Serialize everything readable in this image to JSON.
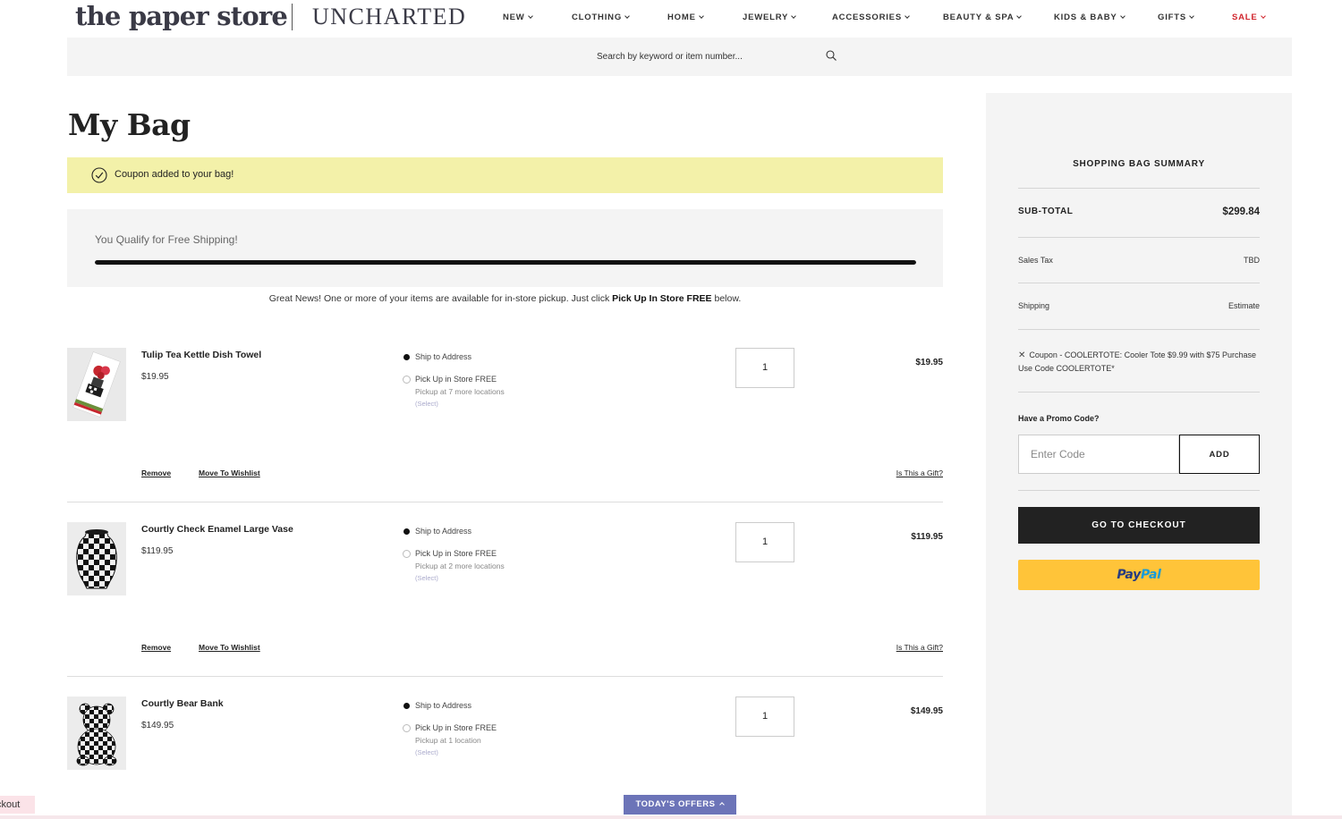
{
  "header": {
    "logo_main": "the paper store",
    "logo_second": "UNCHARTED",
    "nav": [
      {
        "label": "NEW"
      },
      {
        "label": "CLOTHING"
      },
      {
        "label": "HOME"
      },
      {
        "label": "JEWELRY"
      },
      {
        "label": "ACCESSORIES"
      },
      {
        "label": "BEAUTY & SPA"
      },
      {
        "label": "KIDS & BABY"
      },
      {
        "label": "GIFTS"
      },
      {
        "label": "SALE"
      }
    ],
    "search_placeholder": "Search by keyword or item number..."
  },
  "page": {
    "title": "My Bag",
    "coupon_message": "Coupon added to your bag!",
    "free_shipping_text": "You Qualify for Free Shipping!",
    "free_shipping_progress": 1.0,
    "pickup_note_prefix": "Great News! One or more of your items are available for in-store pickup. Just click ",
    "pickup_note_bold": "Pick Up In Store FREE",
    "pickup_note_suffix": " below."
  },
  "items": [
    {
      "name": "Tulip Tea Kettle Dish Towel",
      "price": "$19.95",
      "ship_label": "Ship to Address",
      "pickup_label": "Pick Up in Store FREE",
      "pickup_sub": "Pickup at 7 more locations",
      "pickup_select": "(Select)",
      "quantity": "1",
      "total": "$19.95",
      "remove": "Remove",
      "wishlist": "Move To Wishlist",
      "gift": "Is This a Gift?"
    },
    {
      "name": "Courtly Check Enamel Large Vase",
      "price": "$119.95",
      "ship_label": "Ship to Address",
      "pickup_label": "Pick Up in Store FREE",
      "pickup_sub": "Pickup at 2 more locations",
      "pickup_select": "(Select)",
      "quantity": "1",
      "total": "$119.95",
      "remove": "Remove",
      "wishlist": "Move To Wishlist",
      "gift": "Is This a Gift?"
    },
    {
      "name": "Courtly Bear Bank",
      "price": "$149.95",
      "ship_label": "Ship to Address",
      "pickup_label": "Pick Up in Store FREE",
      "pickup_sub": "Pickup at 1 location",
      "pickup_select": "(Select)",
      "quantity": "1",
      "total": "$149.95"
    }
  ],
  "summary": {
    "title": "SHOPPING BAG SUMMARY",
    "subtotal_label": "SUB-TOTAL",
    "subtotal_value": "$299.84",
    "tax_label": "Sales Tax",
    "tax_value": "TBD",
    "shipping_label": "Shipping",
    "shipping_value": "Estimate",
    "coupon_text": "Coupon - COOLERTOTE: Cooler Tote $9.99 with $75 Purchase Use Code COOLERTOTE*",
    "promo_label": "Have a Promo Code?",
    "promo_placeholder": "Enter Code",
    "promo_add": "ADD",
    "checkout_label": "GO TO CHECKOUT",
    "paypal_part1": "Pay",
    "paypal_part2": "Pal"
  },
  "bottom": {
    "offers_label": "TODAY'S OFFERS",
    "left_tab": "ckout"
  },
  "colors": {
    "coupon_banner": "#f3f1a9",
    "sale": "#d1262e",
    "paypal": "#ffc439",
    "offers_tab": "#6c74b8",
    "checkout": "#222222"
  }
}
